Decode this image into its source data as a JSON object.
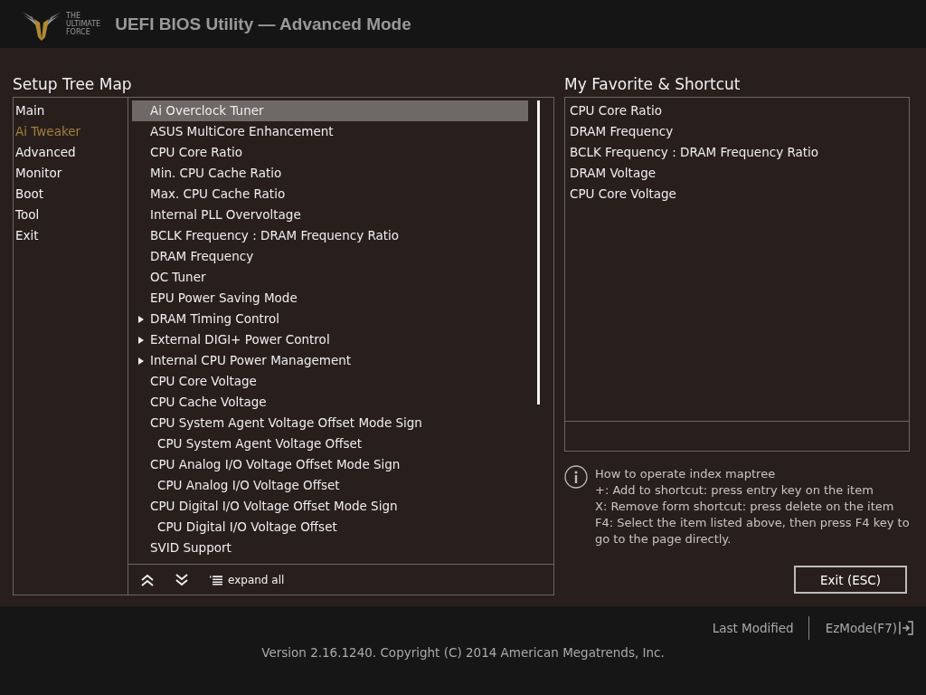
{
  "header": {
    "logo_text": [
      "THE",
      "ULTIMATE",
      "FORCE"
    ],
    "title": "UEFI BIOS Utility — Advanced Mode"
  },
  "setup_tree": {
    "title": "Setup Tree Map",
    "nav": [
      {
        "label": "Main",
        "selected": false
      },
      {
        "label": "Ai Tweaker",
        "selected": true
      },
      {
        "label": "Advanced",
        "selected": false
      },
      {
        "label": "Monitor",
        "selected": false
      },
      {
        "label": "Boot",
        "selected": false
      },
      {
        "label": "Tool",
        "selected": false
      },
      {
        "label": "Exit",
        "selected": false
      }
    ],
    "items": [
      {
        "label": "Ai Overclock Tuner",
        "kind": "item",
        "selected": true
      },
      {
        "label": "ASUS MultiCore Enhancement",
        "kind": "item",
        "selected": false
      },
      {
        "label": "CPU Core Ratio",
        "kind": "item",
        "selected": false
      },
      {
        "label": "Min. CPU Cache Ratio",
        "kind": "item",
        "selected": false
      },
      {
        "label": "Max. CPU Cache Ratio",
        "kind": "item",
        "selected": false
      },
      {
        "label": "Internal PLL Overvoltage",
        "kind": "item",
        "selected": false
      },
      {
        "label": "BCLK Frequency : DRAM Frequency Ratio",
        "kind": "item",
        "selected": false
      },
      {
        "label": "DRAM Frequency",
        "kind": "item",
        "selected": false
      },
      {
        "label": "OC Tuner",
        "kind": "item",
        "selected": false
      },
      {
        "label": "EPU Power Saving Mode",
        "kind": "item",
        "selected": false
      },
      {
        "label": "DRAM Timing Control",
        "kind": "submenu",
        "selected": false
      },
      {
        "label": "External DIGI+ Power Control",
        "kind": "submenu",
        "selected": false
      },
      {
        "label": "Internal CPU Power Management",
        "kind": "submenu",
        "selected": false
      },
      {
        "label": "CPU Core Voltage",
        "kind": "item",
        "selected": false
      },
      {
        "label": "CPU Cache Voltage",
        "kind": "item",
        "selected": false
      },
      {
        "label": "CPU System Agent Voltage Offset Mode Sign",
        "kind": "item",
        "selected": false,
        "children": [
          {
            "label": "CPU System Agent Voltage Offset",
            "selected": false
          }
        ]
      },
      {
        "label": "CPU Analog I/O Voltage Offset Mode Sign",
        "kind": "item",
        "selected": false,
        "children": [
          {
            "label": "CPU Analog I/O Voltage Offset",
            "selected": false
          }
        ]
      },
      {
        "label": "CPU Digital I/O Voltage Offset Mode Sign",
        "kind": "item",
        "selected": false,
        "children": [
          {
            "label": "CPU Digital I/O Voltage Offset",
            "selected": false
          }
        ]
      },
      {
        "label": "SVID Support",
        "kind": "item",
        "selected": false
      }
    ],
    "expand_all": "expand all"
  },
  "favorites": {
    "title": "My Favorite & Shortcut",
    "items": [
      "CPU Core Ratio",
      "DRAM Frequency",
      "BCLK Frequency : DRAM Frequency Ratio",
      "DRAM Voltage",
      "CPU Core Voltage"
    ]
  },
  "help": [
    "How to operate index maptree",
    "+: Add to shortcut: press entry key on the item",
    "X: Remove form shortcut: press delete on the item",
    "F4: Select the item listed above, then press F4 key to go to the page directly."
  ],
  "exit_button": "Exit (ESC)",
  "footer": {
    "last_modified": "Last Modified",
    "ez_mode": "EzMode(F7)",
    "copyright": "Version 2.16.1240. Copyright (C) 2014 American Megatrends, Inc."
  }
}
